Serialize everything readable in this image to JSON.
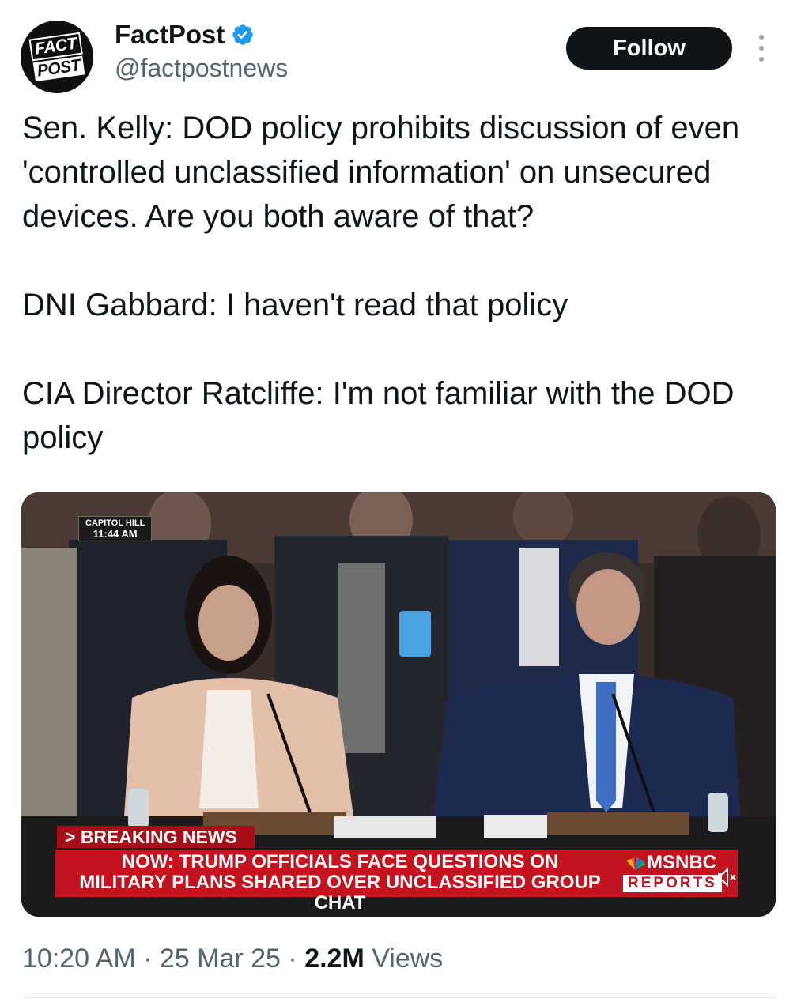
{
  "account": {
    "logo_line1": "FACT",
    "logo_line2": "POST",
    "display_name": "FactPost",
    "verified": true,
    "verified_icon": "verified-badge-icon",
    "verified_color": "#1d9bf0",
    "handle": "@factpostnews",
    "follow_label": "Follow",
    "more_icon": "more-vertical-icon"
  },
  "tweet": {
    "paragraphs": [
      "Sen. Kelly: DOD policy prohibits discussion of even 'controlled unclassified information' on unsecured devices. Are you both aware of that?",
      "DNI Gabbard: I haven't read that policy",
      "CIA Director Ratcliffe: I'm not familiar with the DOD policy"
    ]
  },
  "media": {
    "location": "CAPITOL HILL",
    "time": "11:44 AM",
    "breaking": "> BREAKING NEWS",
    "headline_line1": "NOW: TRUMP OFFICIALS FACE QUESTIONS ON",
    "headline_line2": "MILITARY PLANS SHARED OVER UNCLASSIFIED GROUP CHAT",
    "network": "MSNBC",
    "network_sub": "REPORTS",
    "mute_icon": "muted-speaker-icon",
    "lower_third_color": "#c4121e"
  },
  "meta": {
    "time": "10:20 AM",
    "sep1": " · ",
    "date": "25 Mar 25",
    "sep2": " · ",
    "views_count": "2.2M",
    "views_label": " Views"
  }
}
